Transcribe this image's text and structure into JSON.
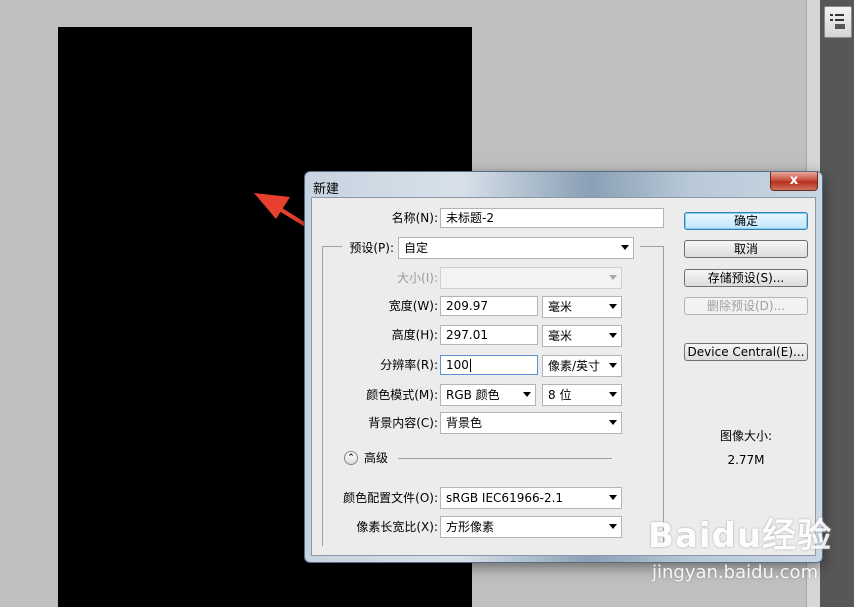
{
  "dialog": {
    "title": "新建",
    "close_label": "x",
    "fields": {
      "name": {
        "label": "名称(N):",
        "value": "未标题-2"
      },
      "preset": {
        "label": "预设(P):",
        "value": "自定"
      },
      "size": {
        "label": "大小(I):",
        "value": ""
      },
      "width": {
        "label": "宽度(W):",
        "value": "209.97",
        "unit": "毫米"
      },
      "height": {
        "label": "高度(H):",
        "value": "297.01",
        "unit": "毫米"
      },
      "resolution": {
        "label": "分辨率(R):",
        "value": "100",
        "unit": "像素/英寸"
      },
      "color_mode": {
        "label": "颜色模式(M):",
        "value": "RGB 颜色",
        "depth": "8 位"
      },
      "background": {
        "label": "背景内容(C):",
        "value": "背景色"
      },
      "advanced": {
        "label": "高级"
      },
      "color_profile": {
        "label": "颜色配置文件(O):",
        "value": "sRGB IEC61966-2.1"
      },
      "pixel_aspect": {
        "label": "像素长宽比(X):",
        "value": "方形像素"
      }
    },
    "buttons": {
      "ok": "确定",
      "cancel": "取消",
      "save_preset": "存储预设(S)...",
      "delete_preset": "删除预设(D)...",
      "device_central": "Device Central(E)..."
    },
    "image_size": {
      "label": "图像大小:",
      "value": "2.77M"
    }
  },
  "watermark": {
    "logo": "Baidu经验",
    "url": "jingyan.baidu.com"
  },
  "colors": {
    "document": "#000000",
    "workspace": "#c0c0c0",
    "arrow": "#e8402f",
    "default_button": "#bee6fd"
  }
}
